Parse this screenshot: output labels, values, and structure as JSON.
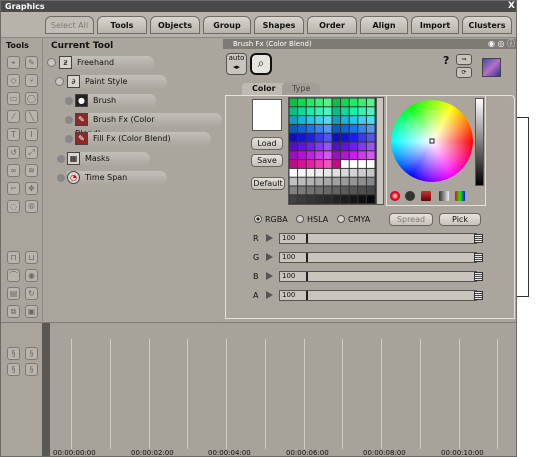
{
  "window": {
    "title": "Graphics",
    "close_glyph": "X"
  },
  "tabs": {
    "select_all": "Select All",
    "tools": "Tools",
    "objects": "Objects",
    "group": "Group",
    "shapes": "Shapes",
    "order": "Order",
    "align": "Align",
    "import": "Import",
    "clusters": "Clusters"
  },
  "sidebar": {
    "label": "Tools"
  },
  "current_tool": {
    "title": "Current Tool",
    "items": {
      "freehand": "Freehand",
      "paint_style": "Paint Style",
      "brush": "Brush",
      "brush_fx": "Brush Fx (Color Blend)",
      "fill_fx": "Fill Fx (Color Blend)",
      "masks": "Masks",
      "time_span": "Time Span"
    }
  },
  "panel": {
    "header": "Brush Fx (Color Blend)",
    "auto_label": "auto",
    "help_glyph": "?",
    "tabs": {
      "color": "Color",
      "type": "Type"
    },
    "buttons": {
      "load": "Load",
      "save": "Save",
      "default": "Default",
      "spread": "Spread",
      "pick": "Pick"
    },
    "modes": {
      "rgba": "RGBA",
      "hsla": "HSLA",
      "cmya": "CMYA"
    },
    "channels": [
      {
        "label": "R",
        "value": "100"
      },
      {
        "label": "G",
        "value": "100"
      },
      {
        "label": "B",
        "value": "100"
      },
      {
        "label": "A",
        "value": "100"
      }
    ]
  },
  "timeline": {
    "labels": [
      "00:00:00:00",
      "00:00:02:00",
      "00:00:04:00",
      "00:00:06:00",
      "00:00:08:00",
      "00:00:10:00"
    ]
  },
  "colors": {
    "window_bg": "#a8a49c",
    "titlebar": "#4a4a4a",
    "panel_header": "#7e7b75"
  }
}
